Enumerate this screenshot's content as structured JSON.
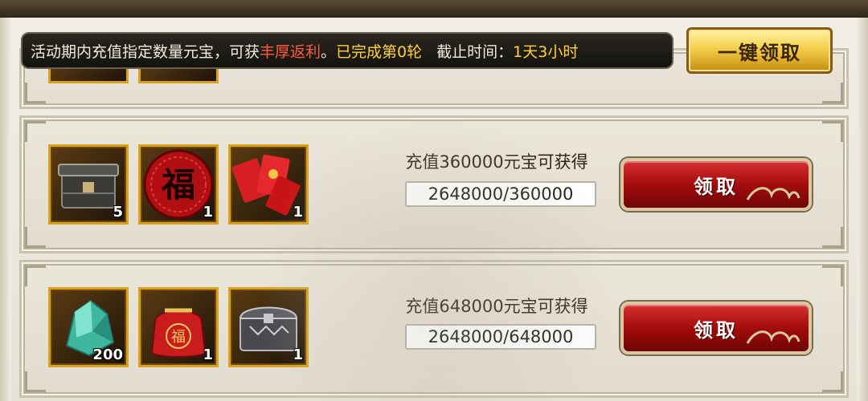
{
  "banner": {
    "text_prefix": "活动期内充值指定数量元宝，可获",
    "text_highlight": "丰厚返利",
    "text_period": "。",
    "text_progress": "已完成第0轮",
    "deadline_label": "截止时间：",
    "deadline_value": "1天3小时"
  },
  "claim_all_label": "一键领取",
  "rows": [
    {
      "requirement": "充值360000元宝可获得",
      "progress": "2648000/360000",
      "claim_label": "领取",
      "items": [
        {
          "icon": "iron-chest-icon",
          "qty": "5"
        },
        {
          "icon": "fu-blessing-icon",
          "qty": "1"
        },
        {
          "icon": "red-envelope-icon",
          "qty": "1"
        }
      ]
    },
    {
      "requirement": "充值648000元宝可获得",
      "progress": "2648000/648000",
      "claim_label": "领取",
      "items": [
        {
          "icon": "jade-crystal-icon",
          "qty": "200"
        },
        {
          "icon": "fu-lucky-bag-icon",
          "qty": "1"
        },
        {
          "icon": "silver-chest-icon",
          "qty": "1"
        }
      ]
    }
  ]
}
